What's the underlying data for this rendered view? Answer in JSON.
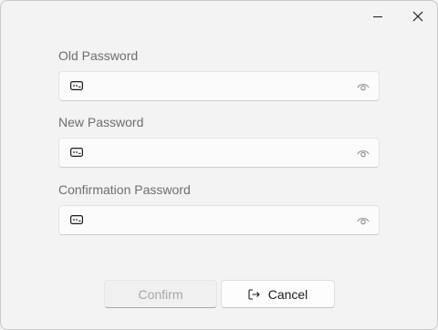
{
  "window": {
    "controls": {
      "minimize": "minimize-icon",
      "close": "close-icon"
    }
  },
  "form": {
    "fields": [
      {
        "label": "Old Password",
        "value": "",
        "placeholder": "",
        "leading_icon": "password-key-icon",
        "trailing_icon": "eye-icon"
      },
      {
        "label": "New Password",
        "value": "",
        "placeholder": "",
        "leading_icon": "password-key-icon",
        "trailing_icon": "eye-icon"
      },
      {
        "label": "Confirmation Password",
        "value": "",
        "placeholder": "",
        "leading_icon": "password-key-icon",
        "trailing_icon": "eye-icon"
      }
    ]
  },
  "actions": {
    "confirm_label": "Confirm",
    "confirm_enabled": false,
    "cancel_label": "Cancel",
    "cancel_icon": "sign-out-icon"
  },
  "colors": {
    "background": "#f3f3f3",
    "label_text": "#6e6e6e",
    "disabled_text": "#a7a7a7",
    "text": "#1b1b1b"
  }
}
